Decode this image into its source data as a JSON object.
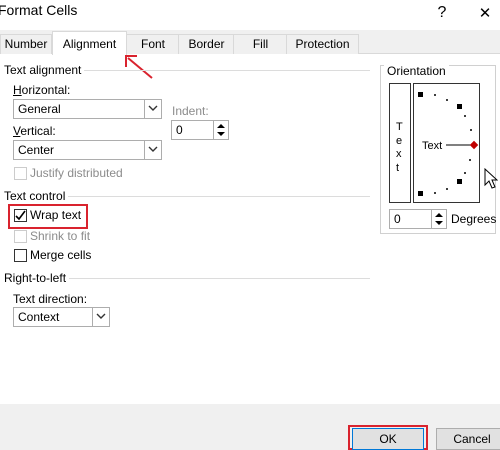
{
  "window": {
    "title": "Format Cells",
    "help": "?",
    "close": "✕"
  },
  "tabs": [
    {
      "label": "Number"
    },
    {
      "label": "Alignment"
    },
    {
      "label": "Font"
    },
    {
      "label": "Border"
    },
    {
      "label": "Fill"
    },
    {
      "label": "Protection"
    }
  ],
  "text_alignment": {
    "heading": "Text alignment",
    "horizontal_label_u": "H",
    "horizontal_label_rest": "orizontal:",
    "horizontal_value": "General",
    "vertical_label_u": "V",
    "vertical_label_rest": "ertical:",
    "vertical_value": "Center",
    "indent_label": "Indent:",
    "indent_value": "0",
    "justify_distributed": "Justify distributed"
  },
  "text_control": {
    "heading": "Text control",
    "wrap_text": "Wrap text",
    "wrap_checked": true,
    "shrink_to_fit": "Shrink to fit",
    "merge_cells": "Merge cells"
  },
  "rtl": {
    "heading": "Right-to-left",
    "direction_label": "Text direction:",
    "direction_value": "Context"
  },
  "orientation": {
    "heading": "Orientation",
    "vertical_letters": [
      "T",
      "e",
      "x",
      "t"
    ],
    "dial_text": "Text",
    "degrees_value": "0",
    "degrees_label": "Degrees"
  },
  "buttons": {
    "ok": "OK",
    "cancel": "Cancel"
  },
  "colors": {
    "highlight": "#d9232e",
    "default_button_border": "#0078d7"
  }
}
